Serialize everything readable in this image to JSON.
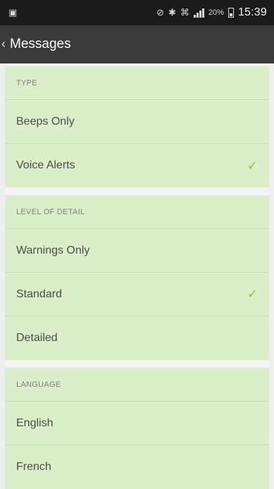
{
  "status_bar": {
    "notification_icon": "screenshot-icon",
    "battery_percent": "20%",
    "time": "15:39"
  },
  "app_bar": {
    "back_icon": "chevron-left-icon",
    "title": "Messages"
  },
  "sections": [
    {
      "header": "TYPE",
      "items": [
        {
          "label": "Beeps Only",
          "selected": false
        },
        {
          "label": "Voice Alerts",
          "selected": true
        }
      ]
    },
    {
      "header": "LEVEL OF DETAIL",
      "items": [
        {
          "label": "Warnings Only",
          "selected": false
        },
        {
          "label": "Standard",
          "selected": true
        },
        {
          "label": "Detailed",
          "selected": false
        }
      ]
    },
    {
      "header": "LANGUAGE",
      "items": [
        {
          "label": "English",
          "selected": false
        },
        {
          "label": "French",
          "selected": false
        }
      ]
    }
  ],
  "colors": {
    "accent_check": "#8cc34a",
    "section_background": "#dbeeca",
    "app_bar": "#3a3a3a",
    "status_bar": "#1b1b1b"
  }
}
